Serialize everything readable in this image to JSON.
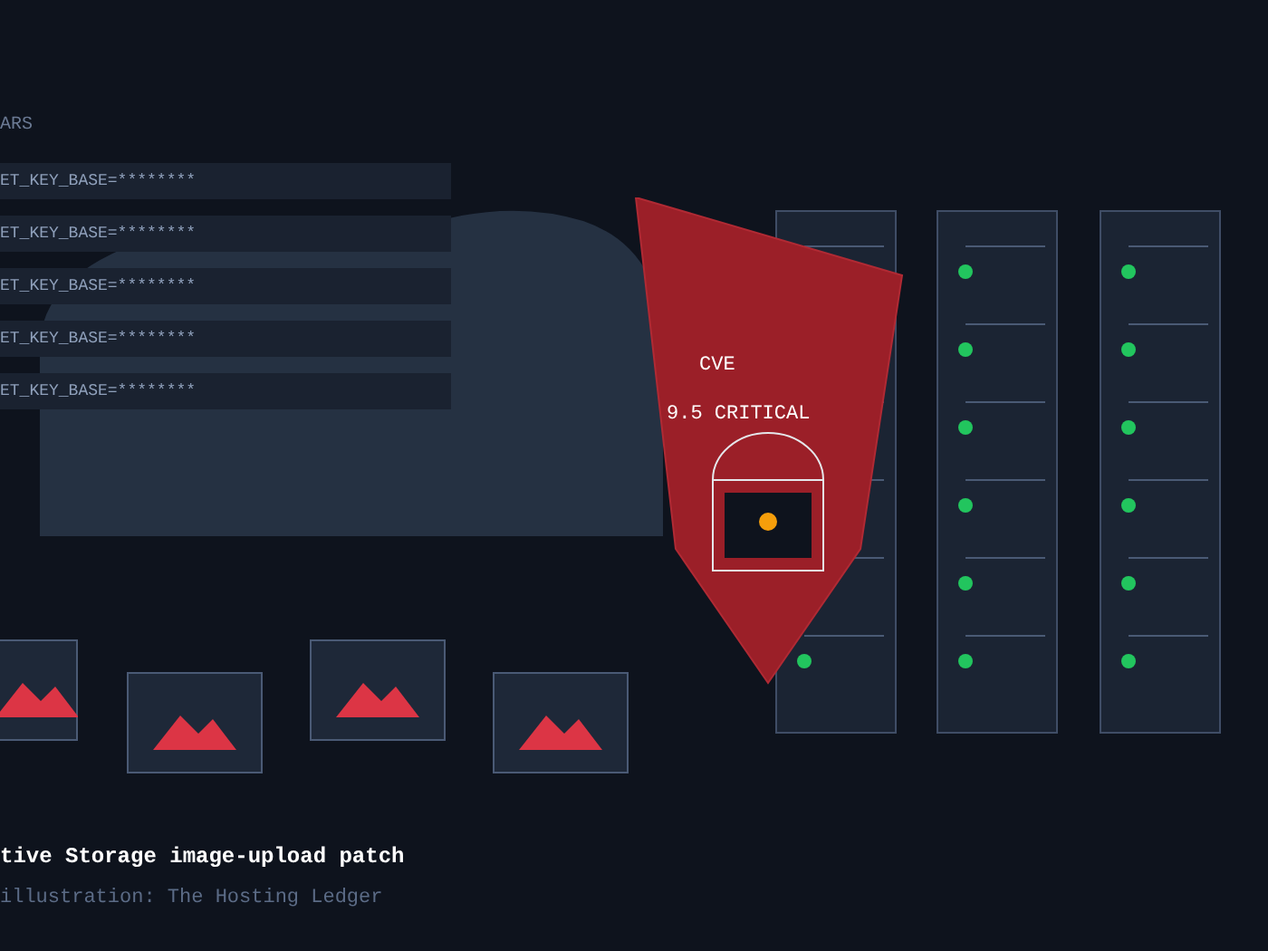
{
  "section_label": "ARS",
  "env_rows": [
    "ET_KEY_BASE=********",
    "ET_KEY_BASE=********",
    "ET_KEY_BASE=********",
    "ET_KEY_BASE=********",
    "ET_KEY_BASE=********"
  ],
  "alert": {
    "title": "CVE",
    "severity": "9.5 CRITICAL"
  },
  "caption": {
    "headline": "tive Storage image-upload patch",
    "credit": "illustration: The Hosting Ledger"
  }
}
